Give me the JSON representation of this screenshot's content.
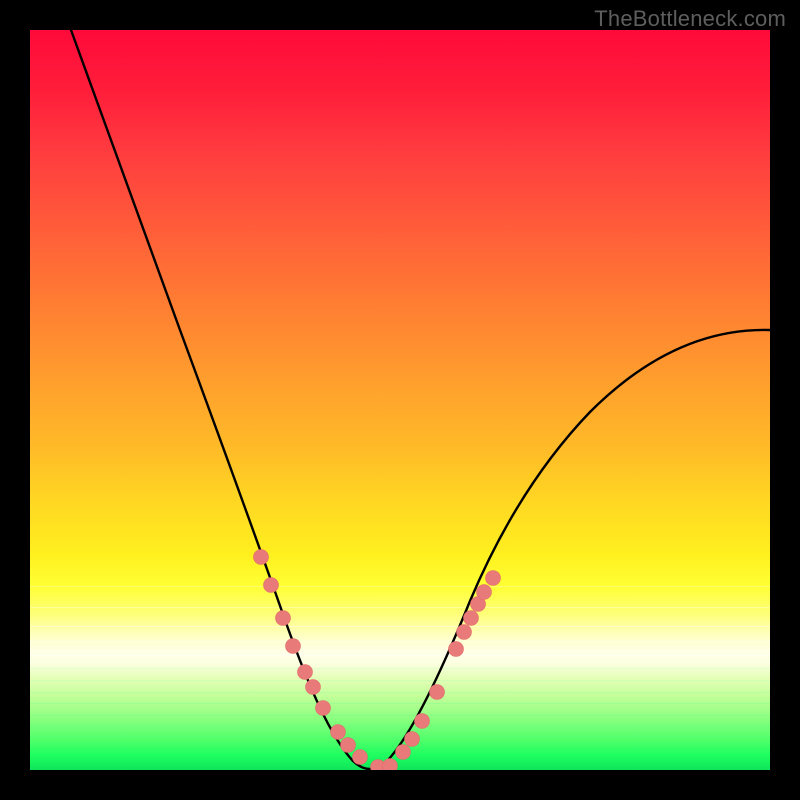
{
  "watermark": "TheBottleneck.com",
  "colors": {
    "background": "#000000",
    "curve_stroke": "#000000",
    "marker_fill": "#e97a7a",
    "marker_stroke": "#e36a6a"
  },
  "chart_data": {
    "type": "line",
    "title": "",
    "xlabel": "",
    "ylabel": "",
    "xlim": [
      0,
      100
    ],
    "ylim": [
      0,
      100
    ],
    "grid": false,
    "note": "No axis ticks or numeric labels are rendered in the image; x/y values below are estimated from pixel position on a 0–100 normalized scale. The background gradient encodes the y-value (red ≈ 100, green ≈ 0). A V-shaped curve reaches its minimum near x≈47.",
    "series": [
      {
        "name": "curve-left",
        "x": [
          5.5,
          10,
          15,
          20,
          25,
          30,
          33,
          36,
          38,
          40,
          42,
          44,
          45.5,
          47
        ],
        "values": [
          100,
          88,
          74,
          60,
          46,
          32,
          24,
          16,
          11,
          7,
          4,
          2,
          0.8,
          0.3
        ]
      },
      {
        "name": "curve-right",
        "x": [
          47,
          50,
          53,
          56,
          59,
          62,
          66,
          72,
          80,
          90,
          100
        ],
        "values": [
          0.3,
          2,
          6,
          12,
          19,
          25,
          32,
          40,
          48,
          55,
          59
        ]
      },
      {
        "name": "markers",
        "type": "scatter",
        "x": [
          31.2,
          32.6,
          34.2,
          35.6,
          37.2,
          38.2,
          39.6,
          41.6,
          43.0,
          44.6,
          47.0,
          48.6,
          50.4,
          51.6,
          53.0,
          55.0,
          57.6,
          58.6,
          59.6,
          60.6,
          61.4,
          62.6
        ],
        "values": [
          28.8,
          25.0,
          20.6,
          16.8,
          13.2,
          11.2,
          8.4,
          5.2,
          3.4,
          1.8,
          0.4,
          0.6,
          2.4,
          4.2,
          6.6,
          10.6,
          16.4,
          18.6,
          20.6,
          22.4,
          24.0,
          26.0
        ]
      }
    ]
  }
}
